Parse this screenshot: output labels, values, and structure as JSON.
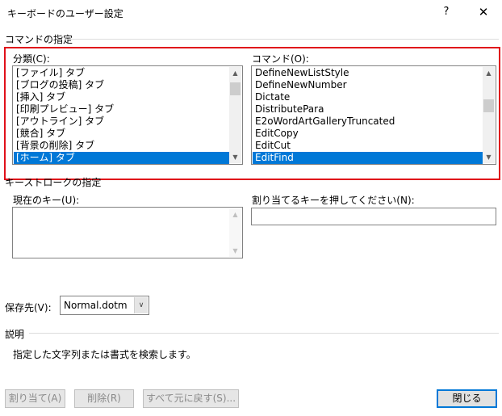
{
  "window": {
    "title": "キーボードのユーザー設定",
    "help": "?",
    "close": "✕"
  },
  "command_section": {
    "label": "コマンドの指定",
    "categories_label": "分類(C):",
    "categories": [
      "[ファイル] タブ",
      "[ブログの投稿] タブ",
      "[挿入] タブ",
      "[印刷プレビュー] タブ",
      "[アウトライン] タブ",
      "[競合] タブ",
      "[背景の削除] タブ",
      "[ホーム] タブ"
    ],
    "commands_label": "コマンド(O):",
    "commands": [
      "DefineNewListStyle",
      "DefineNewNumber",
      "Dictate",
      "DistributePara",
      "E2oWordArtGalleryTruncated",
      "EditCopy",
      "EditCut",
      "EditFind"
    ]
  },
  "keystroke_section": {
    "label": "キーストロークの指定",
    "current_keys_label": "現在のキー(U):",
    "new_key_label": "割り当てるキーを押してください(N):",
    "new_key_value": ""
  },
  "save_in": {
    "label": "保存先(V):",
    "value": "Normal.dotm"
  },
  "description": {
    "label": "説明",
    "text": "指定した文字列または書式を検索します。"
  },
  "buttons": {
    "assign": "割り当て(A)",
    "remove": "削除(R)",
    "reset_all": "すべて元に戻す(S)...",
    "close": "閉じる"
  },
  "icons": {
    "scroll_up": "▲",
    "scroll_down": "▼",
    "combo_down": "∨"
  }
}
